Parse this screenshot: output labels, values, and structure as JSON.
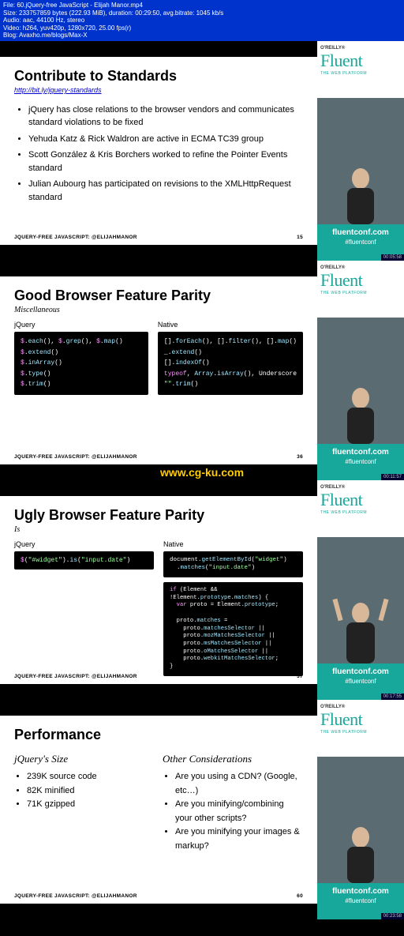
{
  "meta": {
    "file": "File: 60.jQuery-free JavaScript - Elijah Manor.mp4",
    "size": "Size: 233757859 bytes (222.93 MiB), duration: 00:29:50, avg.bitrate: 1045 kb/s",
    "audio": "Audio: aac, 44100 Hz, stereo",
    "video": "Video: h264, yuv420p, 1280x720, 25.00 fps(r)",
    "blog": "Blog: Avaxho.me/blogs/Max-X"
  },
  "side": {
    "oreilly": "O'REILLY®",
    "fluent": "Fluent",
    "webplat": "THE WEB PLATFORM",
    "conf_url": "fluentconf.com",
    "conf_tag": "#fluentconf"
  },
  "watermark": "www.cg-ku.com",
  "footer_label": "JQUERY-FREE JAVASCRIPT: @ELIJAHMANOR",
  "slide1": {
    "title": "Contribute to Standards",
    "link": "http://bit.ly/jquery-standards",
    "bullets": [
      "jQuery has close relations to the browser vendors and communicates standard violations to be fixed",
      "Yehuda Katz & Rick Waldron are active in ECMA TC39 group",
      "Scott González & Kris Borchers worked to refine the Pointer Events standard",
      "Julian Aubourg has participated on revisions to the XMLHttpRequest standard"
    ],
    "page": "15",
    "time": "00:05:58"
  },
  "slide2": {
    "title": "Good Browser Feature Parity",
    "subtitle": "Miscellaneous",
    "left_label": "jQuery",
    "right_label": "Native",
    "page": "36",
    "time": "00:11:57"
  },
  "slide3": {
    "title": "Ugly Browser Feature Parity",
    "subtitle": "Is",
    "left_label": "jQuery",
    "right_label": "Native",
    "page": "37",
    "time": "00:17:55"
  },
  "slide4": {
    "title": "Performance",
    "left_head": "jQuery's Size",
    "right_head": "Other Considerations",
    "left_bullets": [
      "239K source code",
      "  82K minified",
      "  71K gzipped"
    ],
    "right_bullets": [
      "Are you using a CDN? (Google, etc…)",
      "Are you minifying/combining your other scripts?",
      "Are you minifying your images & markup?"
    ],
    "page": "60",
    "time": "00:23:58"
  },
  "chart_data": {
    "type": "table",
    "title": "jQuery Size",
    "rows": [
      {
        "label": "source code",
        "size_kb": 239
      },
      {
        "label": "minified",
        "size_kb": 82
      },
      {
        "label": "gzipped",
        "size_kb": 71
      }
    ]
  }
}
